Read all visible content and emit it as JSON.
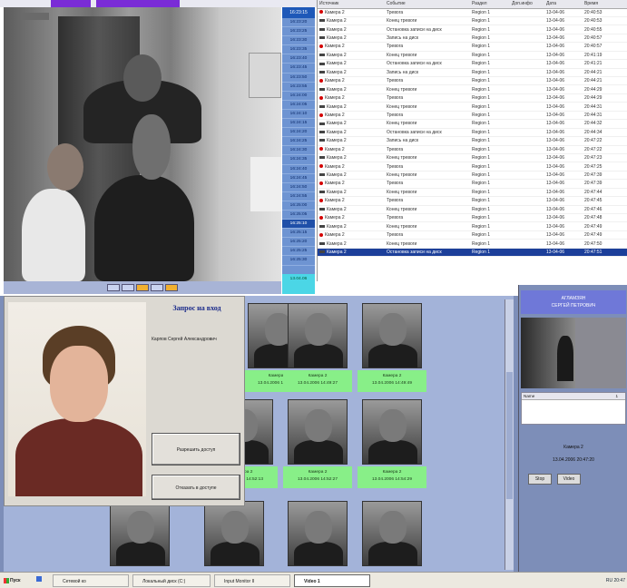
{
  "time_column": {
    "header": "16:23:15",
    "ticks": [
      "16:23:20",
      "16:23:25",
      "16:23:30",
      "16:23:35",
      "16:23:40",
      "16:23:45",
      "16:23:50",
      "16:23:55",
      "16:24:00",
      "16:24:05",
      "16:24:10",
      "16:24:15",
      "16:24:20",
      "16:24:25",
      "16:24:30",
      "16:24:35",
      "16:24:40",
      "16:24:45",
      "16:24:50",
      "16:24:55",
      "16:25:00",
      "16:25:05",
      "16:25:10",
      "16:25:15",
      "16:25:20",
      "16:25:25",
      "16:25:30"
    ],
    "selected_index": 22,
    "footer": "13.04.06"
  },
  "events": {
    "columns": [
      "Источник",
      "Событие",
      "Раздел",
      "Доп.инфо",
      "Дата",
      "Время"
    ],
    "rows": [
      [
        "Камера 2",
        "Тревога",
        "Region 1",
        "",
        "13-04-06",
        "20:40:53",
        "red"
      ],
      [
        "Камера 2",
        "Конец тревоги",
        "Region 1",
        "",
        "13-04-06",
        "20:40:53",
        "cam"
      ],
      [
        "Камера 2",
        "Остановка записи на диск",
        "Region 1",
        "",
        "13-04-06",
        "20:40:55",
        "cam"
      ],
      [
        "Камера 2",
        "Запись на диск",
        "Region 1",
        "",
        "13-04-06",
        "20:40:57",
        "cam"
      ],
      [
        "Камера 2",
        "Тревога",
        "Region 1",
        "",
        "13-04-06",
        "20:40:57",
        "red"
      ],
      [
        "Камера 2",
        "Конец тревоги",
        "Region 1",
        "",
        "13-04-06",
        "20:41:19",
        "cam"
      ],
      [
        "Камера 2",
        "Остановка записи на диск",
        "Region 1",
        "",
        "13-04-06",
        "20:41:21",
        "cam"
      ],
      [
        "Камера 2",
        "Запись на диск",
        "Region 1",
        "",
        "13-04-06",
        "20:44:21",
        "cam"
      ],
      [
        "Камера 2",
        "Тревога",
        "Region 1",
        "",
        "13-04-06",
        "20:44:21",
        "red"
      ],
      [
        "Камера 2",
        "Конец тревоги",
        "Region 1",
        "",
        "13-04-06",
        "20:44:29",
        "cam"
      ],
      [
        "Камера 2",
        "Тревога",
        "Region 1",
        "",
        "13-04-06",
        "20:44:29",
        "red"
      ],
      [
        "Камера 2",
        "Конец тревоги",
        "Region 1",
        "",
        "13-04-06",
        "20:44:31",
        "cam"
      ],
      [
        "Камера 2",
        "Тревога",
        "Region 1",
        "",
        "13-04-06",
        "20:44:31",
        "red"
      ],
      [
        "Камера 2",
        "Конец тревоги",
        "Region 1",
        "",
        "13-04-06",
        "20:44:32",
        "cam"
      ],
      [
        "Камера 2",
        "Остановка записи на диск",
        "Region 1",
        "",
        "13-04-06",
        "20:44:34",
        "cam"
      ],
      [
        "Камера 2",
        "Запись на диск",
        "Region 1",
        "",
        "13-04-06",
        "20:47:22",
        "cam"
      ],
      [
        "Камера 2",
        "Тревога",
        "Region 1",
        "",
        "13-04-06",
        "20:47:22",
        "red"
      ],
      [
        "Камера 2",
        "Конец тревоги",
        "Region 1",
        "",
        "13-04-06",
        "20:47:23",
        "cam"
      ],
      [
        "Камера 2",
        "Тревога",
        "Region 1",
        "",
        "13-04-06",
        "20:47:25",
        "red"
      ],
      [
        "Камера 2",
        "Конец тревоги",
        "Region 1",
        "",
        "13-04-06",
        "20:47:39",
        "cam"
      ],
      [
        "Камера 2",
        "Тревога",
        "Region 1",
        "",
        "13-04-06",
        "20:47:39",
        "red"
      ],
      [
        "Камера 2",
        "Конец тревоги",
        "Region 1",
        "",
        "13-04-06",
        "20:47:44",
        "cam"
      ],
      [
        "Камера 2",
        "Тревога",
        "Region 1",
        "",
        "13-04-06",
        "20:47:45",
        "red"
      ],
      [
        "Камера 2",
        "Конец тревоги",
        "Region 1",
        "",
        "13-04-06",
        "20:47:46",
        "cam"
      ],
      [
        "Камера 2",
        "Тревога",
        "Region 1",
        "",
        "13-04-06",
        "20:47:48",
        "red"
      ],
      [
        "Камера 2",
        "Конец тревоги",
        "Region 1",
        "",
        "13-04-06",
        "20:47:49",
        "cam"
      ],
      [
        "Камера 2",
        "Тревога",
        "Region 1",
        "",
        "13-04-06",
        "20:47:49",
        "red"
      ],
      [
        "Камера 2",
        "Конец тревоги",
        "Region 1",
        "",
        "13-04-06",
        "20:47:50",
        "cam"
      ],
      [
        "Камера 2",
        "Остановка записи на диск",
        "Region 1",
        "",
        "13-04-06",
        "20:47:51",
        "cam"
      ]
    ],
    "selected_index": 28
  },
  "request_dialog": {
    "title": "Запрос на вход",
    "person_name": "Карпов Сергей Александрович",
    "allow_label": "Разрешить доступ",
    "deny_label": "Отказать в доступе"
  },
  "thumbnails": [
    {
      "label1": "Камера 2",
      "label2": "13.04.2006 14:43:35"
    },
    {
      "label1": "Камера 2",
      "label2": "13.04.2006 14:49:27"
    },
    {
      "label1": "Камера 2",
      "label2": "13.04.2006 14:49:49"
    },
    {
      "label1": "Камера 2",
      "label2": "13.04.2006 14:52:13"
    },
    {
      "label1": "Камера 2",
      "label2": "13.04.2006 14:52:27"
    },
    {
      "label1": "Камера 2",
      "label2": "13.04.2006 14:54:29"
    }
  ],
  "right_panel": {
    "header_line1": "АГЛАМЗЯН",
    "header_line2": "СЕРГЕЙ ПЕТРОВИЧ",
    "list_col1": "Name",
    "list_col2": "1",
    "info_camera": "Камера 2",
    "info_time": "13.04.2006 20:47:20",
    "btn1": "Stop",
    "btn2": "Video"
  },
  "taskbar": {
    "start": "Пуск",
    "tasks": [
      "Сетевой ко",
      "Локальный диск (C:)",
      "Input Monitor II",
      "Video 1"
    ],
    "active_index": 3,
    "tray_text": "RU  20:47"
  },
  "colors": {
    "accent_purple": "#7a2cd6",
    "selection_blue": "#1c3f9a",
    "thumb_label_green": "#88ef88",
    "alarm_red": "#d40000"
  }
}
